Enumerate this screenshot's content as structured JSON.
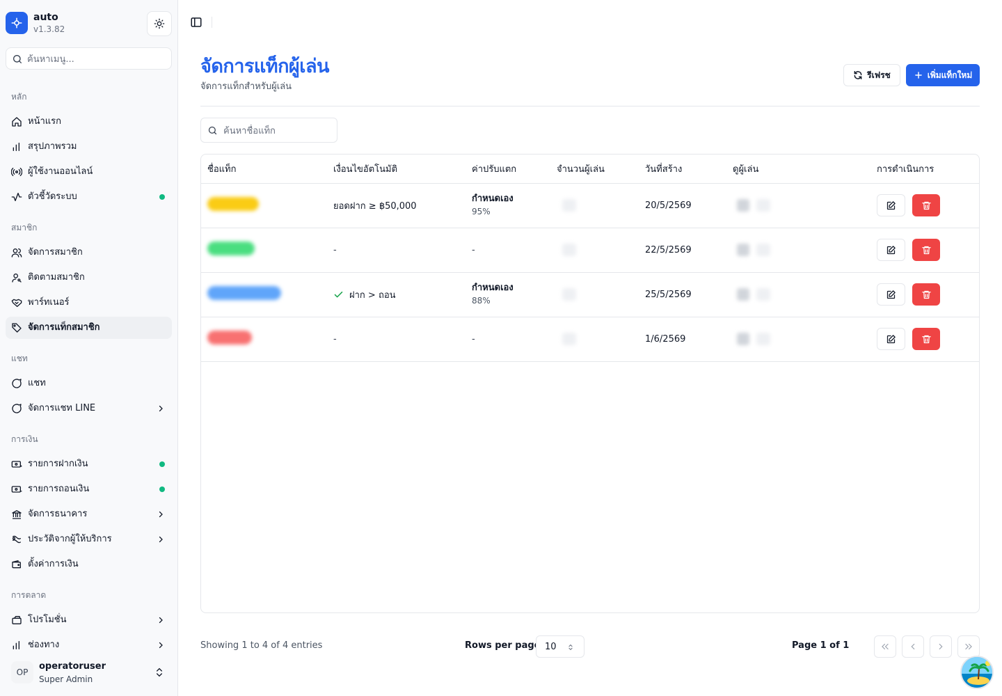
{
  "app": {
    "name": "auto",
    "version": "v1.3.82"
  },
  "sidebar": {
    "search_placeholder": "ค้นหาเมนู...",
    "groups": [
      {
        "label": "หลัก",
        "items": [
          {
            "label": "หน้าแรก",
            "icon": "home-icon"
          },
          {
            "label": "สรุปภาพรวม",
            "icon": "bar-chart-icon"
          },
          {
            "label": "ผู้ใช้งานออนไลน์",
            "icon": "broadcast-icon"
          },
          {
            "label": "ตัวชี้วัดระบบ",
            "icon": "activity-icon",
            "dot": true
          }
        ]
      },
      {
        "label": "สมาชิก",
        "items": [
          {
            "label": "จัดการสมาชิก",
            "icon": "users-icon"
          },
          {
            "label": "ติดตามสมาชิก",
            "icon": "user-search-icon"
          },
          {
            "label": "พาร์ทเนอร์",
            "icon": "handshake-icon"
          },
          {
            "label": "จัดการแท็กสมาชิก",
            "icon": "tag-icon",
            "active": true
          }
        ]
      },
      {
        "label": "แชท",
        "items": [
          {
            "label": "แชท",
            "icon": "message-icon"
          },
          {
            "label": "จัดการแชท LINE",
            "icon": "message-icon",
            "chevron": true
          }
        ]
      },
      {
        "label": "การเงิน",
        "items": [
          {
            "label": "รายการฝากเงิน",
            "icon": "deposit-icon",
            "dot": true
          },
          {
            "label": "รายการถอนเงิน",
            "icon": "withdraw-icon",
            "dot": true
          },
          {
            "label": "จัดการธนาคาร",
            "icon": "bank-icon",
            "chevron": true
          },
          {
            "label": "ประวัติจากผู้ให้บริการ",
            "icon": "history-icon",
            "chevron": true
          },
          {
            "label": "ตั้งค่าการเงิน",
            "icon": "wallet-icon"
          }
        ]
      },
      {
        "label": "การตลาด",
        "items": [
          {
            "label": "โปรโมชั่น",
            "icon": "promotion-icon",
            "chevron": true
          },
          {
            "label": "ช่องทาง",
            "icon": "bar-chart-icon",
            "chevron": true
          }
        ]
      }
    ],
    "user": {
      "initials": "OP",
      "name": "operatoruser",
      "role": "Super Admin"
    }
  },
  "header": {
    "title": "จัดการแท็กผู้เล่น",
    "subtitle": "จัดการแท็กสำหรับผู้เล่น",
    "refresh_label": "รีเฟรช",
    "add_label": "เพิ่มแท็กใหม่"
  },
  "search": {
    "placeholder": "ค้นหาชื่อแท็ก"
  },
  "table": {
    "columns": [
      "ชื่อแท็ก",
      "เงื่อนไขอัตโนมัติ",
      "ค่าปรับแตก",
      "จำนวนผู้เล่น",
      "วันที่สร้าง",
      "ดูผู้เล่น",
      "การดำเนินการ"
    ],
    "rows": [
      {
        "tag_color": "#facc15",
        "condition": "ยอดฝาก ≥ ฿50,000",
        "condition_check": false,
        "penalty": "กำหนดเอง",
        "penalty_pct": "95%",
        "created": "20/5/2569"
      },
      {
        "tag_color": "#4ade80",
        "condition": "-",
        "condition_check": false,
        "penalty": "-",
        "penalty_pct": "",
        "created": "22/5/2569"
      },
      {
        "tag_color": "#60a5fa",
        "condition": "ฝาก > ถอน",
        "condition_check": true,
        "penalty": "กำหนดเอง",
        "penalty_pct": "88%",
        "created": "25/5/2569"
      },
      {
        "tag_color": "#f87171",
        "condition": "-",
        "condition_check": false,
        "penalty": "-",
        "penalty_pct": "",
        "created": "1/6/2569"
      }
    ]
  },
  "footer": {
    "showing": "Showing 1 to 4 of 4 entries",
    "rows_per_page_label": "Rows per page",
    "rows_per_page_value": "10",
    "page_info": "Page 1 of 1"
  },
  "colors": {
    "accent": "#2563eb",
    "danger": "#ef4444",
    "online": "#10b981"
  }
}
